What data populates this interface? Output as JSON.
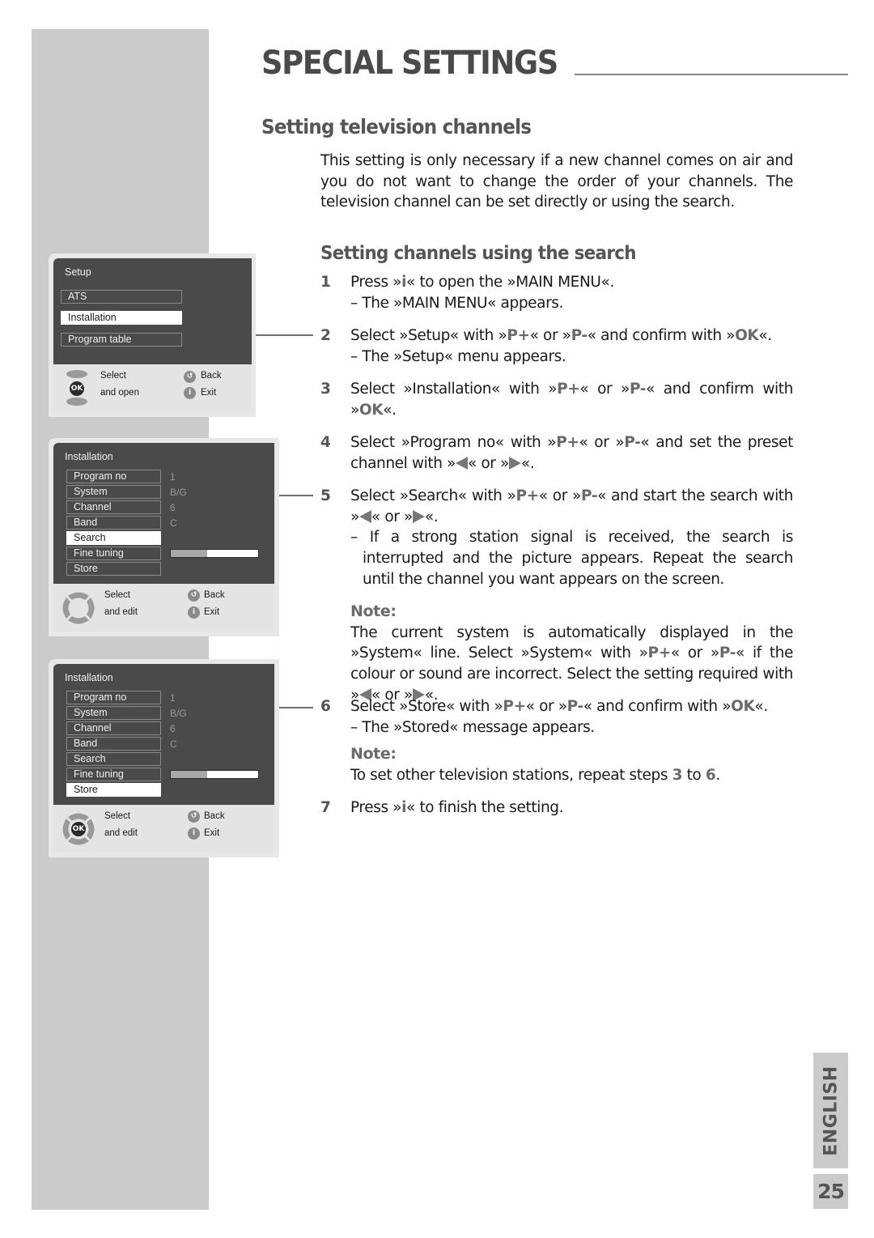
{
  "header": {
    "title": "SPECIAL SETTINGS",
    "section_heading": "Setting television channels",
    "intro": "This setting is only necessary if a new channel comes on air and you do not want to change the order of your channels. The television channel can be set directly or using the search.",
    "sub_heading": "Setting channels using the search"
  },
  "steps": [
    {
      "num": "1",
      "lines": [
        "Press »",
        "i",
        "« to open the »MAIN MENU«."
      ],
      "sub": "– The »MAIN MENU« appears."
    },
    {
      "num": "2",
      "a": "Select »Setup« with »",
      "p_plus": "P+",
      "b": "« or »",
      "p_minus": "P-",
      "c": "« and confirm with »",
      "ok": "OK",
      "d": "«.",
      "sub": "– The »Setup« menu appears."
    },
    {
      "num": "3",
      "a": "Select »Installation« with »",
      "p_plus": "P+",
      "b": "« or »",
      "p_minus": "P-",
      "c": "« and confirm with »",
      "ok": "OK",
      "d": "«."
    },
    {
      "num": "4",
      "a": "Select »Program no« with »",
      "p_plus": "P+",
      "b": "« or »",
      "p_minus": "P-",
      "c": "« and set the preset channel with »",
      "d": "« or »",
      "e": "«."
    },
    {
      "num": "5",
      "a": "Select »Search« with »",
      "p_plus": "P+",
      "b": "« or »",
      "p_minus": "P-",
      "c": "« and start the search with »",
      "d": "« or »",
      "e": "«.",
      "sub": "– If a strong station signal is received, the search is interrupted and the picture appears. Repeat the search until the channel you want appears on the screen."
    },
    {
      "num": "6",
      "a": "Select »Store« with »",
      "p_plus": "P+",
      "b": "« or »",
      "p_minus": "P-",
      "c": "« and confirm with »",
      "ok": "OK",
      "d": "«.",
      "sub": "– The »Stored« message appears."
    },
    {
      "num": "7",
      "a": "Press »",
      "i": "i",
      "b": "« to finish the setting."
    }
  ],
  "notes": [
    {
      "label": "Note:",
      "a": "The current system is automatically displayed in the »System« line. Select »System« with »",
      "p_plus": "P+",
      "b": "« or »",
      "p_minus": "P-",
      "c": "« if the colour or sound are incorrect. Select the setting required with »",
      "d": "« or »",
      "e": "«."
    },
    {
      "label": "Note:",
      "a": "To set other television stations, repeat steps ",
      "from": "3",
      "b": " to ",
      "to": "6",
      "c": "."
    }
  ],
  "osd_setup": {
    "title": "Setup",
    "items": [
      "ATS",
      "Installation",
      "Program table"
    ],
    "selected": "Installation",
    "footer": {
      "nav_line1": "Select",
      "nav_line2": "and open",
      "back": "Back",
      "exit": "Exit",
      "ok": "OK"
    }
  },
  "osd_install_search": {
    "title": "Installation",
    "items": [
      "Program no",
      "System",
      "Channel",
      "Band",
      "Search",
      "Fine tuning",
      "Store"
    ],
    "values": [
      "1",
      "B/G",
      "6",
      "C",
      "",
      "",
      ""
    ],
    "selected": "Search",
    "fine_tuning_level": 0.42,
    "footer": {
      "nav_line1": "Select",
      "nav_line2": "and edit",
      "back": "Back",
      "exit": "Exit"
    }
  },
  "osd_install_store": {
    "title": "Installation",
    "items": [
      "Program no",
      "System",
      "Channel",
      "Band",
      "Search",
      "Fine tuning",
      "Store"
    ],
    "values": [
      "1",
      "B/G",
      "6",
      "C",
      "",
      "",
      ""
    ],
    "selected": "Store",
    "fine_tuning_level": 0.42,
    "footer": {
      "nav_line1": "Select",
      "nav_line2": "and edit",
      "back": "Back",
      "exit": "Exit",
      "ok": "OK"
    }
  },
  "footer": {
    "language": "ENGLISH",
    "page_number": "25"
  }
}
